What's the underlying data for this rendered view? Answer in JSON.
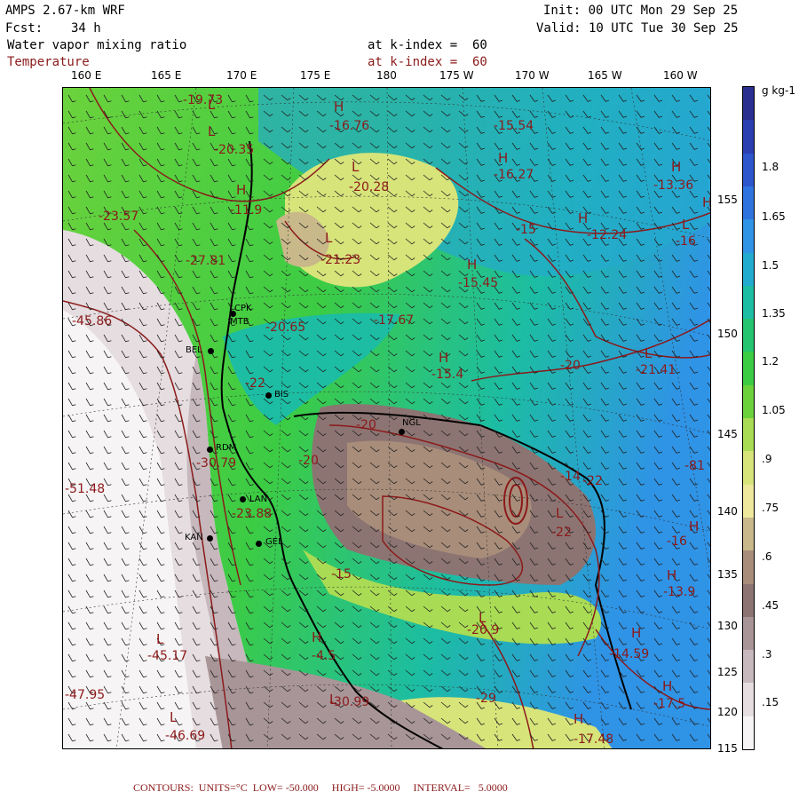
{
  "header": {
    "model": "AMPS 2.67-km WRF",
    "fcst_label": "Fcst:",
    "fcst_value": "34 h",
    "init": "Init: 00 UTC Mon 29 Sep 25",
    "valid": "Valid: 10 UTC Tue 30 Sep 25",
    "field1_name": "Water vapor mixing ratio",
    "field1_level": "at k-index =  60",
    "field2_name": "Temperature",
    "field2_level": "at k-index =  60"
  },
  "longitude_labels": [
    "160 E",
    "165 E",
    "170 E",
    "175 E",
    "180",
    "175 W",
    "170 W",
    "165 W",
    "160 W"
  ],
  "latitude_labels": [
    "155",
    "150",
    "145",
    "140",
    "135",
    "130",
    "125",
    "120",
    "115"
  ],
  "colorbar": {
    "units": "g kg-1",
    "labels": [
      "1.8",
      "1.65",
      "1.5",
      "1.35",
      "1.2",
      "1.05",
      ".9",
      ".75",
      ".6",
      ".45",
      ".3",
      ".15"
    ],
    "colors": [
      "#2b2f8f",
      "#2c3fb0",
      "#2d55cc",
      "#2f73de",
      "#2f93e6",
      "#23aacf",
      "#1cbda3",
      "#24c471",
      "#3ccc44",
      "#6bd23c",
      "#a9dc54",
      "#d7e47a",
      "#eee89c",
      "#c9b88a",
      "#a88d7a",
      "#8c7472",
      "#a89598",
      "#c6b8bd",
      "#e5dde0",
      "#f7f4f5"
    ]
  },
  "stations": [
    {
      "id": "CPK"
    },
    {
      "id": "MTB"
    },
    {
      "id": "BEL"
    },
    {
      "id": "BIS"
    },
    {
      "id": "NGL"
    },
    {
      "id": "RDM"
    },
    {
      "id": "LAN"
    },
    {
      "id": "KAN"
    },
    {
      "id": "GEL"
    }
  ],
  "highs_lows": [
    "L",
    "L",
    "H",
    "H",
    "H",
    "H",
    "L",
    "H",
    "H",
    "L",
    "L",
    "H",
    "L",
    "L",
    "H",
    "H",
    "L",
    "H",
    "H",
    "H",
    "L",
    "L",
    "H",
    "L",
    "H"
  ],
  "contour_values": [
    "-19.73",
    "-16.76",
    "-15.54",
    "-20.35",
    "-16.27",
    "-13.36",
    "-20.28",
    "-11.9",
    "-23.57",
    "-15",
    "-12.24",
    "-16",
    "-21.23",
    "-27.81",
    "-15.45",
    "-45.86",
    "-20.65",
    "-17.67",
    "-15.4",
    "-20",
    "-21.41",
    "-22",
    "-22",
    "-20",
    "-20",
    "-30.79",
    "-81",
    "-14",
    "-51.48",
    "-23.88",
    "-22",
    "-16",
    "-15",
    "-13.9",
    "-20.9",
    "-45.17",
    "-14.59",
    "-47.95",
    "-29",
    "-4.5",
    "-17.5",
    "-30.99",
    "-17.48",
    "-46.69"
  ],
  "footer": {
    "text": "CONTOURS:  UNITS=°C  LOW= -50.000     HIGH= -5.0000     INTERVAL=   5.0000"
  }
}
